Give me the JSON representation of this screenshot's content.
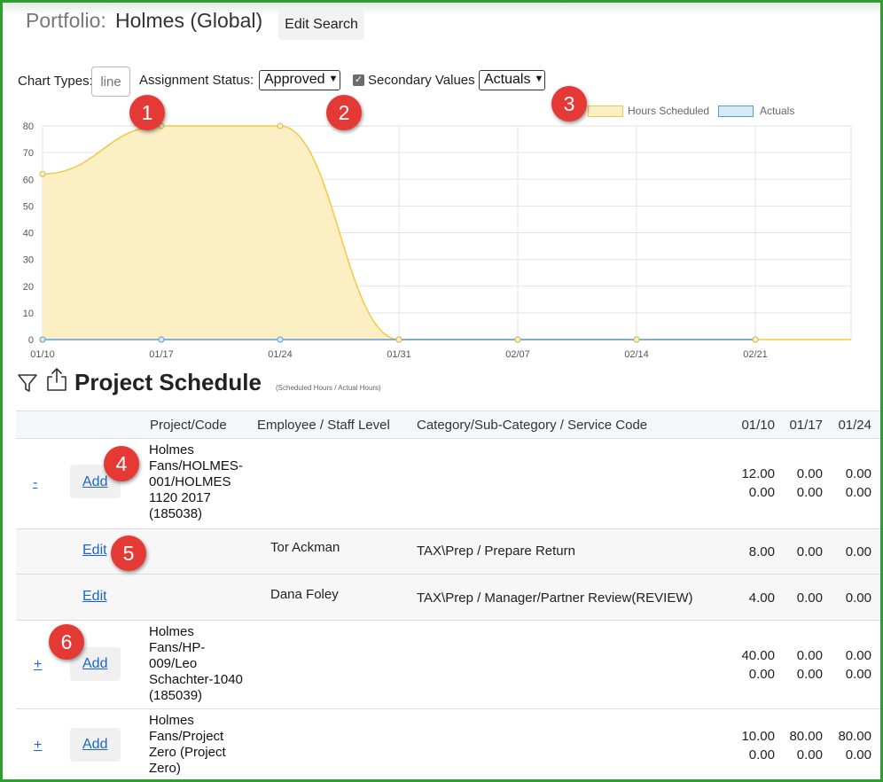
{
  "header": {
    "portfolio_label": "Portfolio:",
    "portfolio_name": "Holmes (Global)",
    "edit_search_label": "Edit Search"
  },
  "controls": {
    "chart_types_label": "Chart Types:",
    "chart_types_placeholder": "line",
    "assignment_status_label": "Assignment Status:",
    "assignment_status_value": "Approved",
    "secondary_values_label": "Secondary Values",
    "secondary_values_checked": true,
    "secondary_values_select": "Actuals"
  },
  "callouts": [
    "1",
    "2",
    "3",
    "4",
    "5",
    "6"
  ],
  "colors": {
    "hours_scheduled_fill": "#fcefc4",
    "hours_scheduled_line": "#f5c842",
    "actuals_fill": "#d5e9f7",
    "actuals_line": "#5b9bd5",
    "callout": "#e53935",
    "link": "#1a66cc",
    "frame": "#2e9e2e"
  },
  "chart_data": {
    "type": "area",
    "x": [
      "01/10",
      "01/17",
      "01/24",
      "01/31",
      "02/07",
      "02/14",
      "02/21"
    ],
    "series": [
      {
        "name": "Hours Scheduled",
        "values": [
          62,
          80,
          80,
          0,
          0,
          0,
          0
        ]
      },
      {
        "name": "Actuals",
        "values": [
          0,
          0,
          0,
          0,
          0,
          0,
          0
        ]
      }
    ],
    "y_ticks": [
      0,
      10,
      20,
      30,
      40,
      50,
      60,
      70,
      80
    ],
    "ylim": [
      0,
      80
    ],
    "grid": true,
    "legend": "top-right"
  },
  "schedule": {
    "title": "Project Schedule",
    "subtitle": "(Scheduled Hours / Actual Hours)",
    "columns": {
      "project": "Project/Code",
      "employee": "Employee / Staff Level",
      "category": "Category/Sub-Category / Service Code",
      "w1": "01/10",
      "w2": "01/17",
      "w3": "01/24"
    },
    "rows": [
      {
        "toggle": "-",
        "action": "Add",
        "project": "Holmes Fans/HOLMES-001/HOLMES 1120 2017 (185038)",
        "w1": [
          "12.00",
          "0.00"
        ],
        "w2": [
          "0.00",
          "0.00"
        ],
        "w3": [
          "0.00",
          "0.00"
        ]
      },
      {
        "action": "Edit",
        "employee": "Tor Ackman",
        "category": "TAX\\Prep / Prepare Return",
        "w1": "8.00",
        "w2": "0.00",
        "w3": "0.00"
      },
      {
        "action": "Edit",
        "employee": "Dana Foley",
        "category": "TAX\\Prep / Manager/Partner Review(REVIEW)",
        "w1": "4.00",
        "w2": "0.00",
        "w3": "0.00"
      },
      {
        "toggle": "+",
        "action": "Add",
        "project": "Holmes Fans/HP-009/Leo Schachter-1040 (185039)",
        "w1": [
          "40.00",
          "0.00"
        ],
        "w2": [
          "0.00",
          "0.00"
        ],
        "w3": [
          "0.00",
          "0.00"
        ]
      },
      {
        "toggle": "+",
        "action": "Add",
        "project": "Holmes Fans/Project Zero (Project Zero)",
        "w1": [
          "10.00",
          "0.00"
        ],
        "w2": [
          "80.00",
          "0.00"
        ],
        "w3": [
          "80.00",
          "0.00"
        ]
      }
    ]
  }
}
